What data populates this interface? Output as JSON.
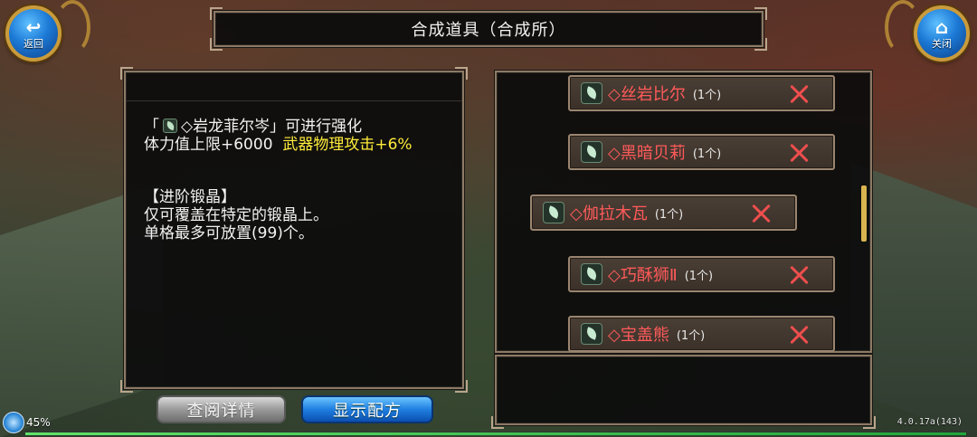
{
  "top_buttons": {
    "back_label": "返回",
    "back_icon": "back-arrow-icon",
    "close_label": "关闭",
    "close_icon": "home-icon"
  },
  "title": "合成道具（合成所）",
  "description": {
    "line1_open": "「",
    "line1_item": "◇岩龙菲尔岑」可进行强化",
    "line2_hp": "体力值上限+6000",
    "line2_attack": "武器物理攻击+6%",
    "line3": "【进阶锻晶】",
    "line4": "仅可覆盖在特定的锻晶上。",
    "line5": "单格最多可放置(99)个。"
  },
  "items": [
    {
      "name": "◇丝岩比尔",
      "count": "(1个)"
    },
    {
      "name": "◇黑暗贝莉",
      "count": "(1个)"
    },
    {
      "name": "◇伽拉木瓦",
      "count": "(1个)"
    },
    {
      "name": "◇巧酥狮Ⅱ",
      "count": "(1个)"
    },
    {
      "name": "◇宝盖熊",
      "count": "(1个)"
    }
  ],
  "buttons": {
    "detail": "查阅详情",
    "recipe": "显示配方"
  },
  "status": {
    "battery_pct": "45%",
    "version": "4.0.17a(143)"
  },
  "colors": {
    "item_name": "#ff5a5a",
    "highlight": "#ffec3a",
    "remove_x": "#ee4e4e"
  }
}
